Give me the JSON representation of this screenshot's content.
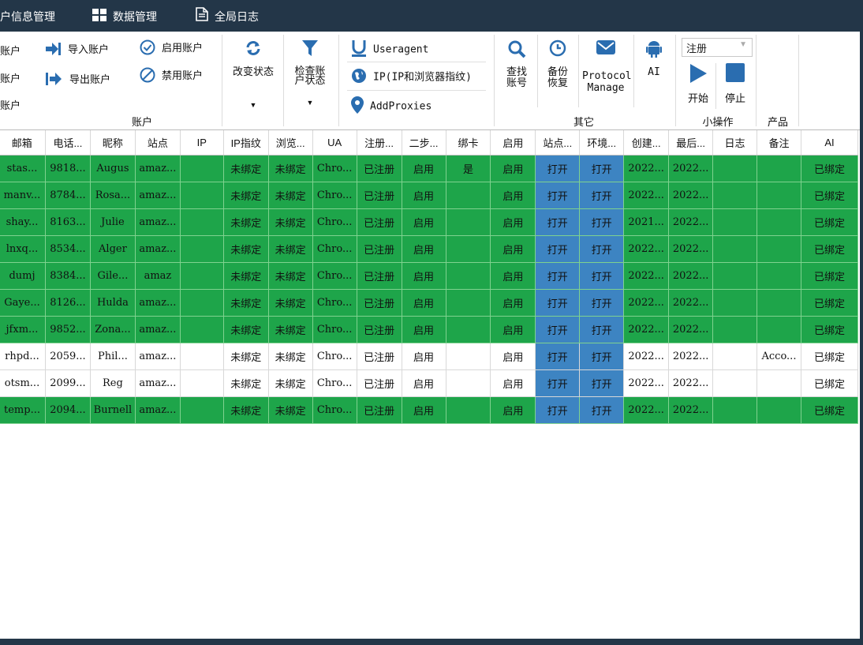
{
  "menubar": {
    "items": [
      {
        "label": "户信息管理"
      },
      {
        "label": "数据管理",
        "icon": "grid-icon"
      },
      {
        "label": "全局日志",
        "icon": "document-icon"
      }
    ]
  },
  "ribbon": {
    "account": {
      "left_partial": [
        "账户",
        "账户",
        "账户"
      ],
      "import": "导入账户",
      "export": "导出账户",
      "enable": "启用账户",
      "disable": "禁用账户",
      "group_label": "账户"
    },
    "change_status": "改变状态",
    "check_status": "检查账户状态",
    "useragent": "Useragent",
    "ip_fingerprint": "IP(IP和浏览器指纹)",
    "add_proxies": "AddProxies",
    "find_account": "查找账号",
    "backup_restore": "备份恢复",
    "protocol_manage": "Protocol Manage",
    "ai": "AI",
    "other_group_label": "其它",
    "mode_select": "注册",
    "start": "开始",
    "stop": "停止",
    "small_ops_label": "小操作",
    "product_label": "产品"
  },
  "grid": {
    "columns": [
      "邮箱",
      "电话...",
      "昵称",
      "站点",
      "IP",
      "IP指纹",
      "浏览...",
      "UA",
      "注册...",
      "二步...",
      "绑卡",
      "启用",
      "站点...",
      "环境...",
      "创建...",
      "最后...",
      "日志",
      "备注",
      "AI"
    ],
    "rows": [
      {
        "style": "green",
        "cells": [
          "stas...",
          "9818...",
          "Augus",
          "amaz...",
          "",
          "未绑定",
          "未绑定",
          "Chro...",
          "已注册",
          "启用",
          "是",
          "启用",
          "打开",
          "打开",
          "2022...",
          "2022...",
          "",
          "",
          "已绑定"
        ]
      },
      {
        "style": "green",
        "cells": [
          "manv...",
          "8784...",
          "Rosa...",
          "amaz...",
          "",
          "未绑定",
          "未绑定",
          "Chro...",
          "已注册",
          "启用",
          "",
          "启用",
          "打开",
          "打开",
          "2022...",
          "2022...",
          "",
          "",
          "已绑定"
        ]
      },
      {
        "style": "green",
        "cells": [
          "shay...",
          "8163...",
          "Julie",
          "amaz...",
          "",
          "未绑定",
          "未绑定",
          "Chro...",
          "已注册",
          "启用",
          "",
          "启用",
          "打开",
          "打开",
          "2021...",
          "2022...",
          "",
          "",
          "已绑定"
        ]
      },
      {
        "style": "green",
        "cells": [
          "lnxq...",
          "8534...",
          "Alger",
          "amaz...",
          "",
          "未绑定",
          "未绑定",
          "Chro...",
          "已注册",
          "启用",
          "",
          "启用",
          "打开",
          "打开",
          "2022...",
          "2022...",
          "",
          "",
          "已绑定"
        ]
      },
      {
        "style": "green",
        "cells": [
          "dumj",
          "8384...",
          "Gile...",
          "amaz",
          "",
          "未绑定",
          "未绑定",
          "Chro...",
          "已注册",
          "启用",
          "",
          "启用",
          "打开",
          "打开",
          "2022...",
          "2022...",
          "",
          "",
          "已绑定"
        ]
      },
      {
        "style": "green",
        "cells": [
          "Gaye...",
          "8126...",
          "Hulda",
          "amaz...",
          "",
          "未绑定",
          "未绑定",
          "Chro...",
          "已注册",
          "启用",
          "",
          "启用",
          "打开",
          "打开",
          "2022...",
          "2022...",
          "",
          "",
          "已绑定"
        ]
      },
      {
        "style": "green",
        "cells": [
          "jfxm...",
          "9852...",
          "Zona...",
          "amaz...",
          "",
          "未绑定",
          "未绑定",
          "Chro...",
          "已注册",
          "启用",
          "",
          "启用",
          "打开",
          "打开",
          "2022...",
          "2022...",
          "",
          "",
          "已绑定"
        ]
      },
      {
        "style": "white",
        "cells": [
          "rhpd...",
          "2059...",
          "Phil...",
          "amaz...",
          "",
          "未绑定",
          "未绑定",
          "Chro...",
          "已注册",
          "启用",
          "",
          "启用",
          "打开",
          "打开",
          "2022...",
          "2022...",
          "",
          "Acco...",
          "已绑定"
        ]
      },
      {
        "style": "white",
        "cells": [
          "otsm...",
          "2099...",
          "Reg",
          "amaz...",
          "",
          "未绑定",
          "未绑定",
          "Chro...",
          "已注册",
          "启用",
          "",
          "启用",
          "打开",
          "打开",
          "2022...",
          "2022...",
          "",
          "",
          "已绑定"
        ]
      },
      {
        "style": "green",
        "cells": [
          "temp...",
          "2094...",
          "Burnell",
          "amaz...",
          "",
          "未绑定",
          "未绑定",
          "Chro...",
          "已注册",
          "启用",
          "",
          "启用",
          "打开",
          "打开",
          "2022...",
          "2022...",
          "",
          "",
          "已绑定"
        ]
      }
    ]
  },
  "colors": {
    "green_row": "#1ea54a",
    "open_button": "#3d84c2",
    "titlebar": "#233648",
    "accent_icon": "#2a6db0"
  }
}
